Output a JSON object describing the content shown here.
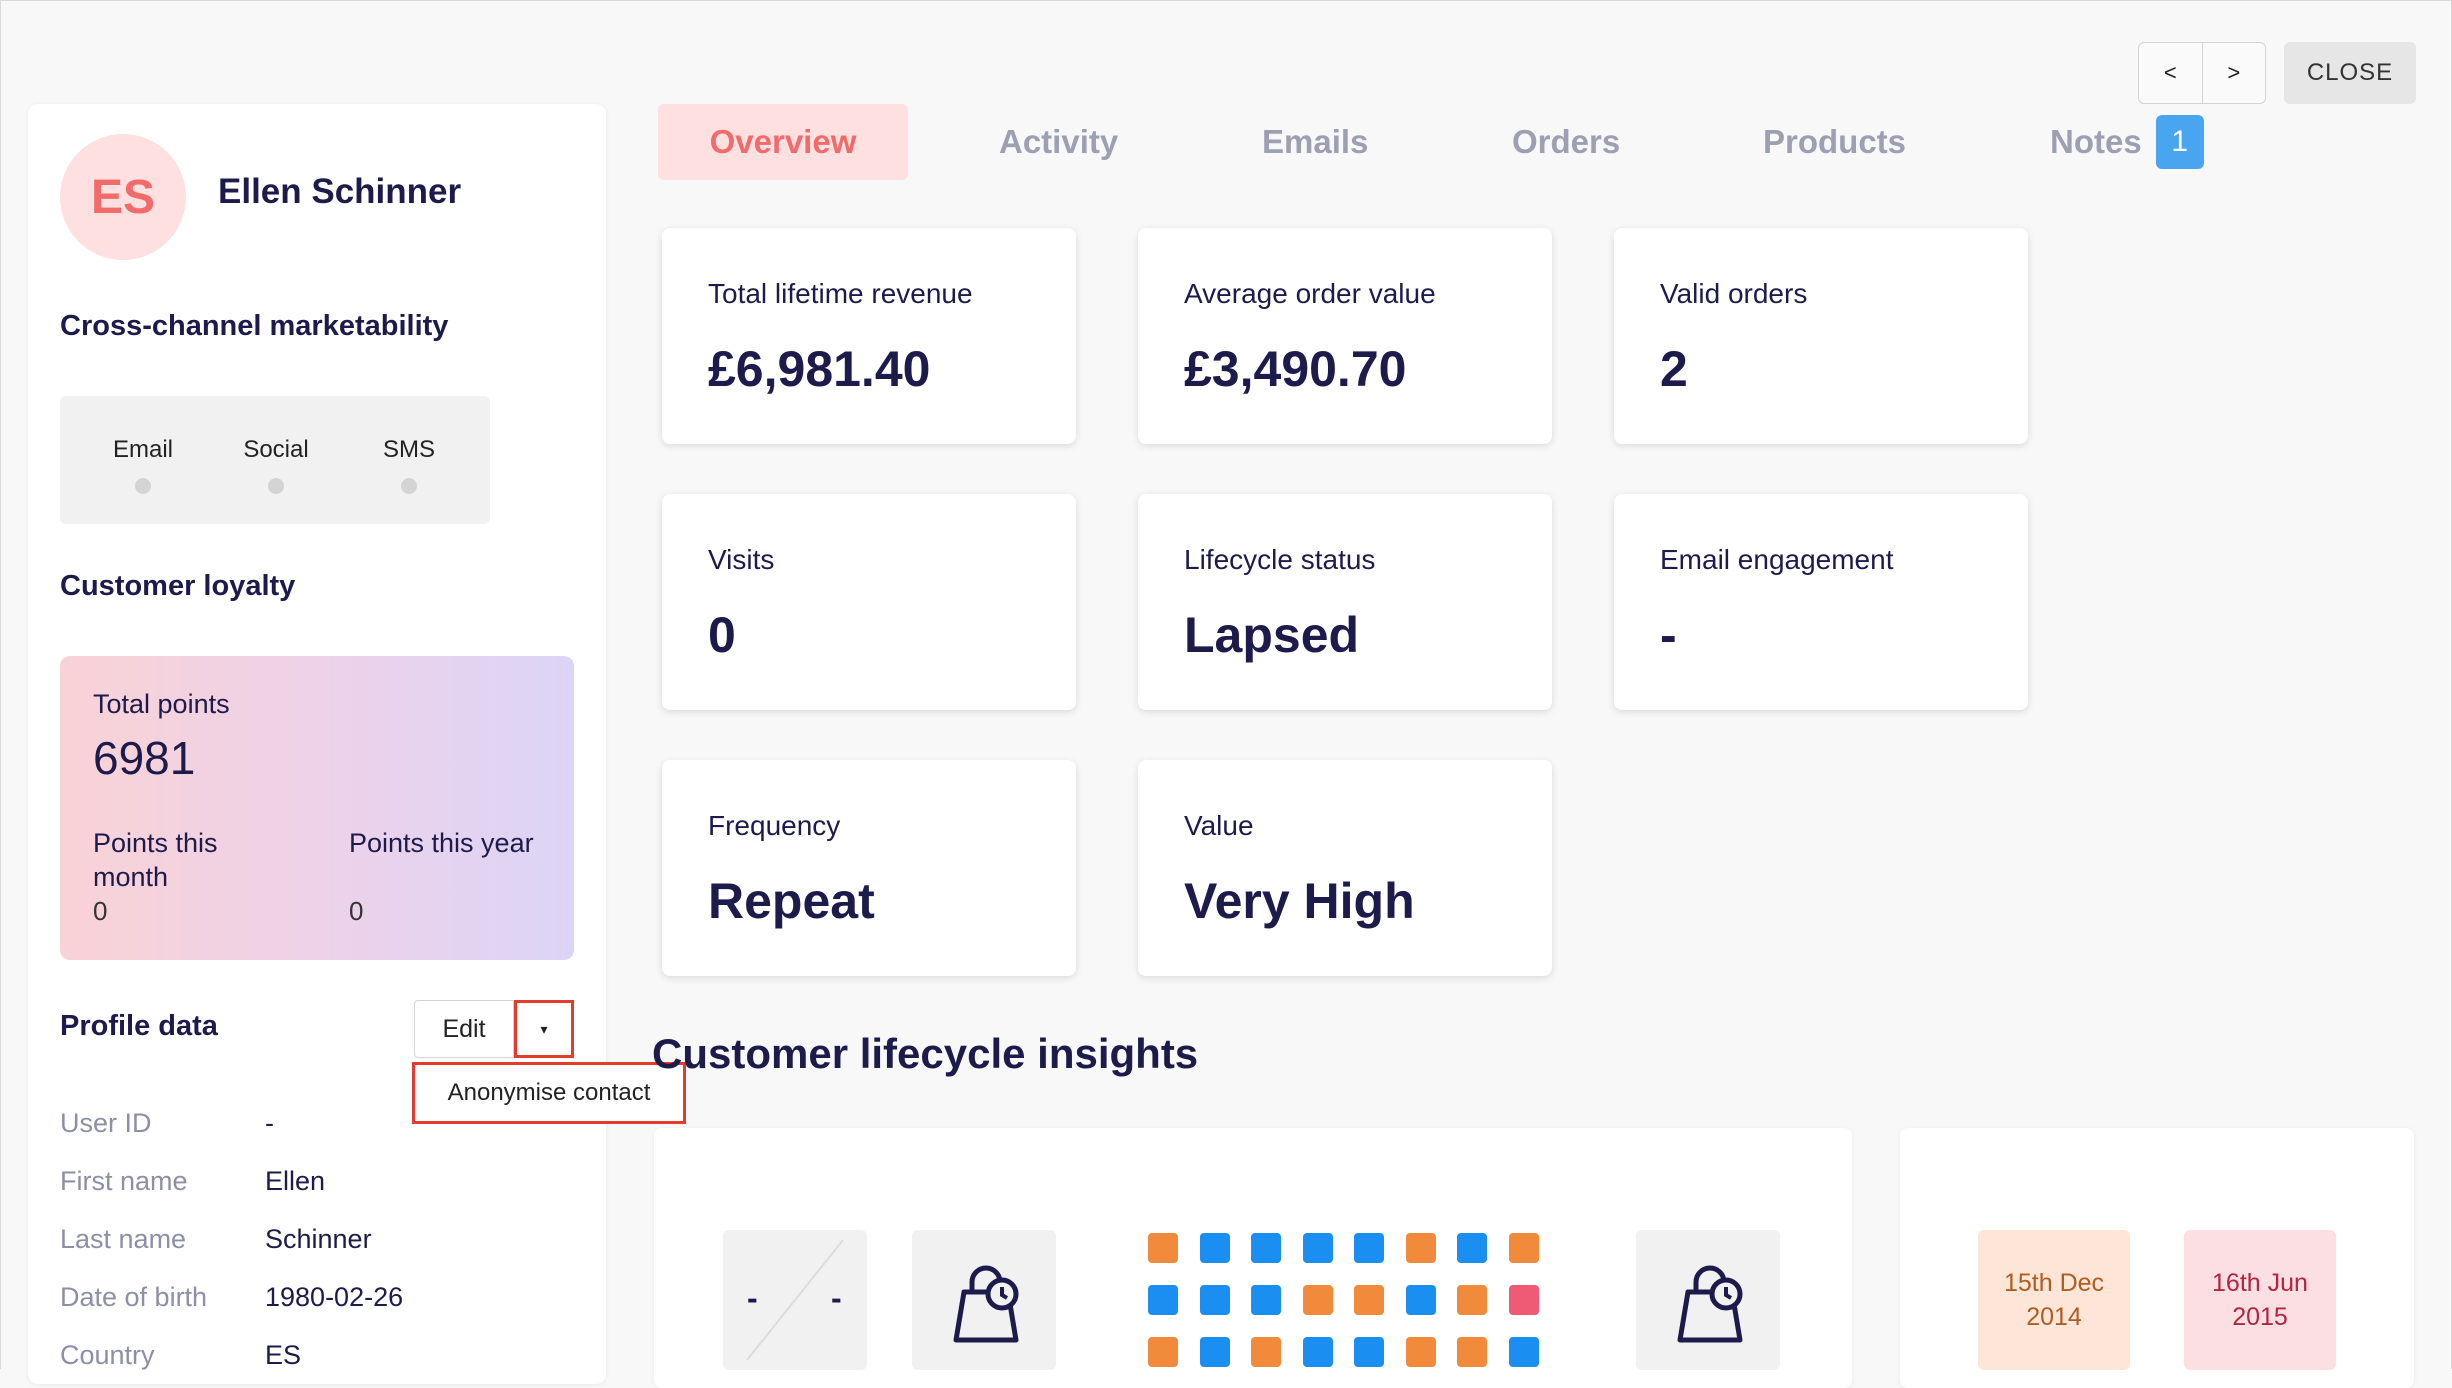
{
  "nav": {
    "prev": "<",
    "next": ">",
    "close": "CLOSE"
  },
  "contact": {
    "initials": "ES",
    "name": "Ellen Schinner"
  },
  "marketability": {
    "title": "Cross-channel marketability",
    "channels": [
      "Email",
      "Social",
      "SMS"
    ]
  },
  "loyalty": {
    "title": "Customer loyalty",
    "total_label": "Total points",
    "total_value": "6981",
    "month_label": "Points this month",
    "month_value": "0",
    "year_label": "Points this year",
    "year_value": "0"
  },
  "profile": {
    "title": "Profile data",
    "edit": "Edit",
    "caret": "▾",
    "dropdown_item": "Anonymise contact",
    "rows": [
      {
        "key": "User ID",
        "value": "-"
      },
      {
        "key": "First name",
        "value": "Ellen"
      },
      {
        "key": "Last name",
        "value": "Schinner"
      },
      {
        "key": "Date of birth",
        "value": "1980-02-26"
      },
      {
        "key": "Country",
        "value": "ES"
      }
    ]
  },
  "tabs": [
    "Overview",
    "Activity",
    "Emails",
    "Orders",
    "Products",
    "Notes"
  ],
  "notes_badge": "1",
  "metrics": [
    {
      "label": "Total lifetime revenue",
      "value": "£6,981.40"
    },
    {
      "label": "Average order value",
      "value": "£3,490.70"
    },
    {
      "label": "Valid orders",
      "value": "2"
    },
    {
      "label": "Visits",
      "value": "0"
    },
    {
      "label": "Lifecycle status",
      "value": "Lapsed"
    },
    {
      "label": "Email engagement",
      "value": "-"
    },
    {
      "label": "Frequency",
      "value": "Repeat"
    },
    {
      "label": "Value",
      "value": "Very High"
    }
  ],
  "insights": {
    "title": "Customer lifecycle insights",
    "placeholder_left": "-",
    "placeholder_right": "-",
    "first_date": "15th Dec 2014",
    "last_date": "16th Jun 2015"
  },
  "colors": {
    "orange": "#f28a3b",
    "blue": "#1b8ef2",
    "pink": "#ef5b75"
  }
}
